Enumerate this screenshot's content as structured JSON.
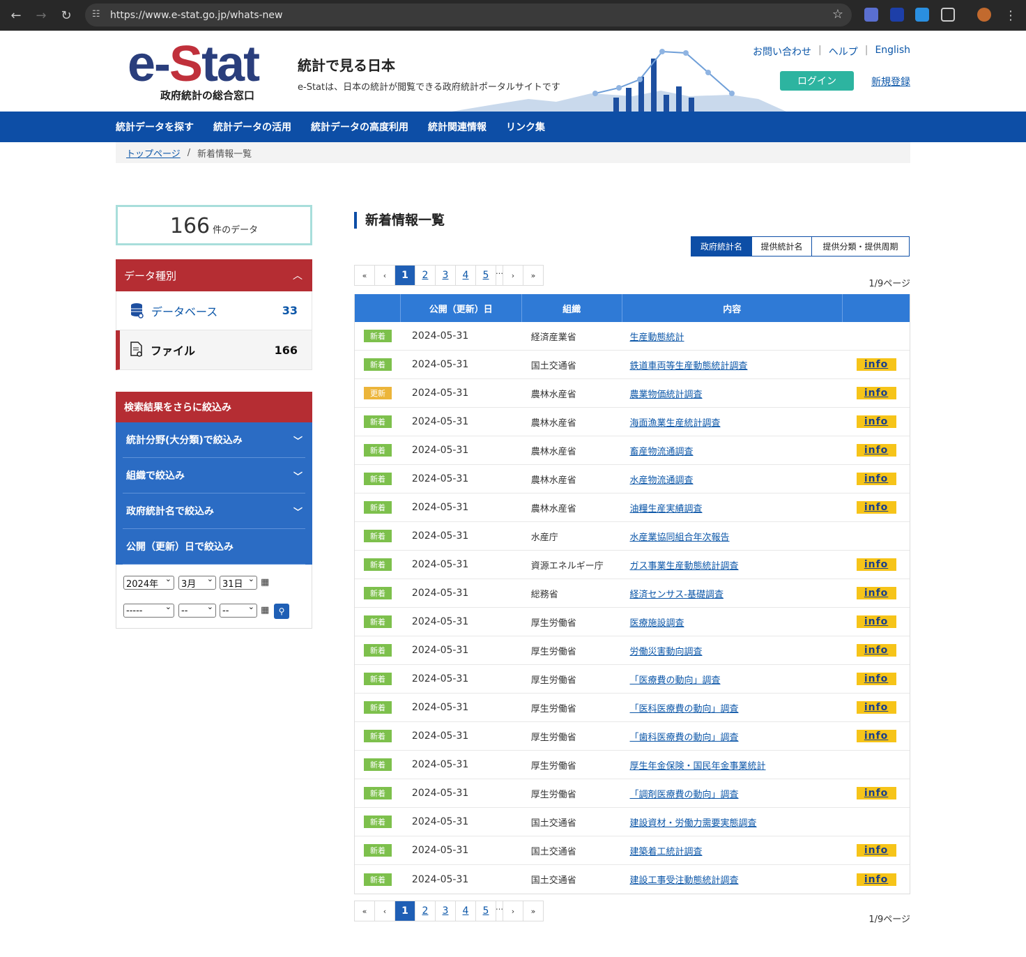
{
  "browser": {
    "url": "https://www.e-stat.go.jp/whats-new",
    "back": "←",
    "forward": "→",
    "reload": "↻",
    "menu": "⋮",
    "star_icon": "star-icon"
  },
  "header": {
    "logo_pre": "e-",
    "logo_s": "S",
    "logo_post": "tat",
    "logo_sub": "政府統計の総合窓口",
    "title": "統計で見る日本",
    "tagline": "e-Statは、日本の統計が閲覧できる政府統計ポータルサイトです",
    "links": {
      "contact": "お問い合わせ",
      "help": "ヘルプ",
      "english": "English",
      "sep": "|"
    },
    "login": "ログイン",
    "signup": "新規登録"
  },
  "gnav": [
    "統計データを探す",
    "統計データの活用",
    "統計データの高度利用",
    "統計関連情報",
    "リンク集"
  ],
  "breadcrumb": {
    "home": "トップページ",
    "sep": "/",
    "current": "新着情報一覧"
  },
  "sidebar": {
    "count": "166",
    "count_unit": "件のデータ",
    "data_type_title": "データ種別",
    "data_types": [
      {
        "label": "データベース",
        "count": "33"
      },
      {
        "label": "ファイル",
        "count": "166"
      }
    ],
    "refine_title": "検索結果をさらに絞込み",
    "filters": [
      "統計分野(大分類)で絞込み",
      "組織で絞込み",
      "政府統計名で絞込み",
      "公開（更新）日で絞込み"
    ],
    "date_from": {
      "year": "2024年",
      "month": "3月",
      "day": "31日"
    },
    "date_to": {
      "year": "-----",
      "month": "--",
      "day": "--"
    },
    "calendar_icon": "calendar-icon",
    "search_icon": "search-icon"
  },
  "main": {
    "title": "新着情報一覧",
    "tabs": [
      "政府統計名",
      "提供統計名",
      "提供分類・提供周期"
    ],
    "pager": {
      "first": "«",
      "prev": "‹",
      "pages": [
        "1",
        "2",
        "3",
        "4",
        "5"
      ],
      "dots": "…",
      "next": "›",
      "last": "»",
      "current": "1"
    },
    "page_count": "1/9ページ",
    "columns": [
      "",
      "公開（更新）日",
      "組織",
      "内容",
      ""
    ],
    "info_label": "info",
    "rows": [
      {
        "badge": "新着",
        "date": "2024-05-31",
        "org": "経済産業省",
        "content": "生産動態統計",
        "info": false
      },
      {
        "badge": "新着",
        "date": "2024-05-31",
        "org": "国土交通省",
        "content": "鉄道車両等生産動態統計調査",
        "info": true
      },
      {
        "badge": "更新",
        "date": "2024-05-31",
        "org": "農林水産省",
        "content": "農業物価統計調査",
        "info": true
      },
      {
        "badge": "新着",
        "date": "2024-05-31",
        "org": "農林水産省",
        "content": "海面漁業生産統計調査",
        "info": true
      },
      {
        "badge": "新着",
        "date": "2024-05-31",
        "org": "農林水産省",
        "content": "畜産物流通調査",
        "info": true
      },
      {
        "badge": "新着",
        "date": "2024-05-31",
        "org": "農林水産省",
        "content": "水産物流通調査",
        "info": true
      },
      {
        "badge": "新着",
        "date": "2024-05-31",
        "org": "農林水産省",
        "content": "油糧生産実績調査",
        "info": true
      },
      {
        "badge": "新着",
        "date": "2024-05-31",
        "org": "水産庁",
        "content": "水産業協同組合年次報告",
        "info": false
      },
      {
        "badge": "新着",
        "date": "2024-05-31",
        "org": "資源エネルギー庁",
        "content": "ガス事業生産動態統計調査",
        "info": true
      },
      {
        "badge": "新着",
        "date": "2024-05-31",
        "org": "総務省",
        "content": "経済センサス-基礎調査",
        "info": true
      },
      {
        "badge": "新着",
        "date": "2024-05-31",
        "org": "厚生労働省",
        "content": "医療施設調査",
        "info": true
      },
      {
        "badge": "新着",
        "date": "2024-05-31",
        "org": "厚生労働省",
        "content": "労働災害動向調査",
        "info": true
      },
      {
        "badge": "新着",
        "date": "2024-05-31",
        "org": "厚生労働省",
        "content": "「医療費の動向」調査",
        "info": true
      },
      {
        "badge": "新着",
        "date": "2024-05-31",
        "org": "厚生労働省",
        "content": "「医科医療費の動向」調査",
        "info": true
      },
      {
        "badge": "新着",
        "date": "2024-05-31",
        "org": "厚生労働省",
        "content": "「歯科医療費の動向」調査",
        "info": true
      },
      {
        "badge": "新着",
        "date": "2024-05-31",
        "org": "厚生労働省",
        "content": "厚生年金保険・国民年金事業統計",
        "info": false
      },
      {
        "badge": "新着",
        "date": "2024-05-31",
        "org": "厚生労働省",
        "content": "「調剤医療費の動向」調査",
        "info": true
      },
      {
        "badge": "新着",
        "date": "2024-05-31",
        "org": "国土交通省",
        "content": "建設資材・労働力需要実態調査",
        "info": false
      },
      {
        "badge": "新着",
        "date": "2024-05-31",
        "org": "国土交通省",
        "content": "建築着工統計調査",
        "info": true
      },
      {
        "badge": "新着",
        "date": "2024-05-31",
        "org": "国土交通省",
        "content": "建設工事受注動態統計調査",
        "info": true
      }
    ]
  }
}
